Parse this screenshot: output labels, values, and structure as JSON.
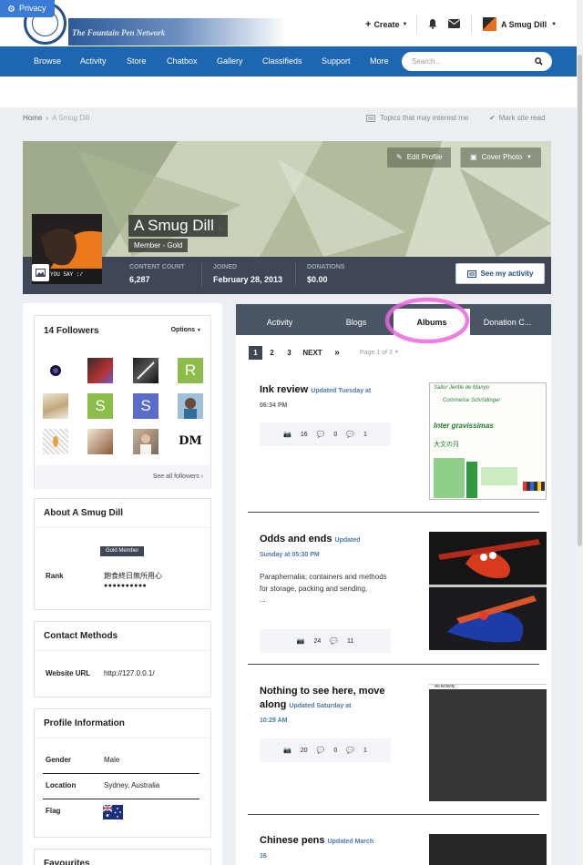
{
  "privacy": {
    "label": "Privacy"
  },
  "logo": {
    "text": "The Fountain Pen Network"
  },
  "header": {
    "create_label": "Create",
    "user_name": "A Smug Dill"
  },
  "nav": {
    "items": [
      "Browse",
      "Activity",
      "Store",
      "Chatbox",
      "Gallery",
      "Classifieds",
      "Support",
      "More"
    ],
    "search_placeholder": "Search..."
  },
  "breadcrumb": {
    "home": "Home",
    "separator": "›",
    "current": "A Smug Dill"
  },
  "page_actions": {
    "topics": "Topics that may interest me",
    "mark_read": "Mark site read"
  },
  "profile": {
    "name": "A Smug Dill",
    "group": "Member - Gold",
    "edit_profile": "Edit Profile",
    "cover_photo": "Cover Photo",
    "avatar_caption": "YOU SAY :/",
    "stats": [
      {
        "label": "CONTENT COUNT",
        "value": "6,287"
      },
      {
        "label": "JOINED",
        "value": "February 28, 2013"
      },
      {
        "label": "DONATIONS",
        "value": "$0.00"
      }
    ],
    "see_activity": "See my activity"
  },
  "followers": {
    "title": "14 Followers",
    "options": "Options",
    "see_all": "See all followers",
    "letters": [
      "R",
      "S",
      "S"
    ],
    "logo_text": "DM"
  },
  "about": {
    "title": "About A Smug Dill",
    "badge": "Gold Member",
    "rank_label": "Rank",
    "rank_value": "飽食終日無所用心",
    "rank_dots": "●●●●●●●●●●"
  },
  "contact": {
    "title": "Contact Methods",
    "website_label": "Website URL",
    "website_value": "http://127.0.0.1/"
  },
  "profile_info": {
    "title": "Profile Information",
    "gender_label": "Gender",
    "gender_value": "Male",
    "location_label": "Location",
    "location_value": "Sydney, Australia",
    "flag_label": "Flag"
  },
  "favourites": {
    "title": "Favourites"
  },
  "tabs": [
    "Activity",
    "Blogs",
    "Albums",
    "Donation C..."
  ],
  "pagination": {
    "pages": [
      "1",
      "2",
      "3"
    ],
    "next": "NEXT",
    "last": "»",
    "page_of": "Page 1 of 3"
  },
  "albums": [
    {
      "title": "Ink review",
      "updated": "Updated Tuesday at",
      "time": "06:34 PM",
      "images": "16",
      "comments": "0",
      "reviews": "1"
    },
    {
      "title": "Odds and ends",
      "updated": "Updated",
      "time": "Sunday at 05:30 PM",
      "desc": "Paraphernalia; containers and methods for storage, packing and sending.",
      "ellipsis": "...",
      "images": "24",
      "reviews": "11"
    },
    {
      "title": "Nothing to see here, move along",
      "updated": "Updated Saturday at",
      "time": "10:29 AM",
      "images": "20",
      "comments": "0",
      "reviews": "1",
      "thumb_label": "All Activity"
    },
    {
      "title": "Chinese pens",
      "updated": "Updated March",
      "time": "16"
    }
  ],
  "ink_review_text": {
    "l1": "Sailor Jentle de Manyo",
    "l2": "Commerce Schrödinger",
    "l3": "Inter gravissimas",
    "l4": "大文の月"
  }
}
